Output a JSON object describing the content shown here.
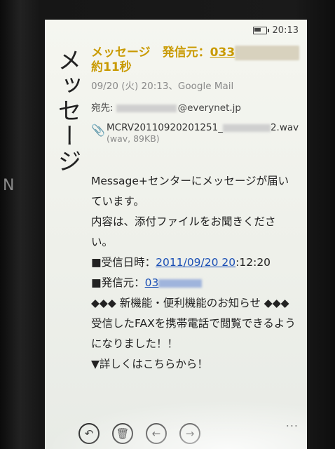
{
  "side_glyph": "N",
  "status": {
    "time": "20:13"
  },
  "pivot": {
    "title": "メッセージ"
  },
  "email": {
    "subject_prefix": "メッセージ　発信元：",
    "subject_number": "033",
    "subject_suffix": "約11秒",
    "meta": "09/20 (火) 20:13、Google Mail",
    "recipient_label": "宛先:",
    "recipient_domain": "@everynet.jp",
    "attachment": {
      "name_start": "MCRV20110920201251_",
      "name_end": "2.wav",
      "info": "(wav, 89KB)"
    },
    "body": {
      "line1": "Message+センターにメッセージが届いています。",
      "line2": "内容は、添付ファイルをお聞きください。",
      "received_label": "■受信日時：",
      "received_link": "2011/09/20 20",
      "received_rest": ":12:20",
      "sender_label": "■発信元：",
      "sender_link": "03",
      "notice": "◆◆◆ 新機能・便利機能のお知らせ ◆◆◆",
      "line3": "受信したFAXを携帯電話で閲覧できるようになりました！！",
      "line4": "▼詳しくはこちらから！"
    }
  },
  "app_bar": {
    "reply_icon": "↶",
    "delete_icon": "🗑",
    "prev_icon": "←",
    "next_icon": "→",
    "more": "..."
  }
}
